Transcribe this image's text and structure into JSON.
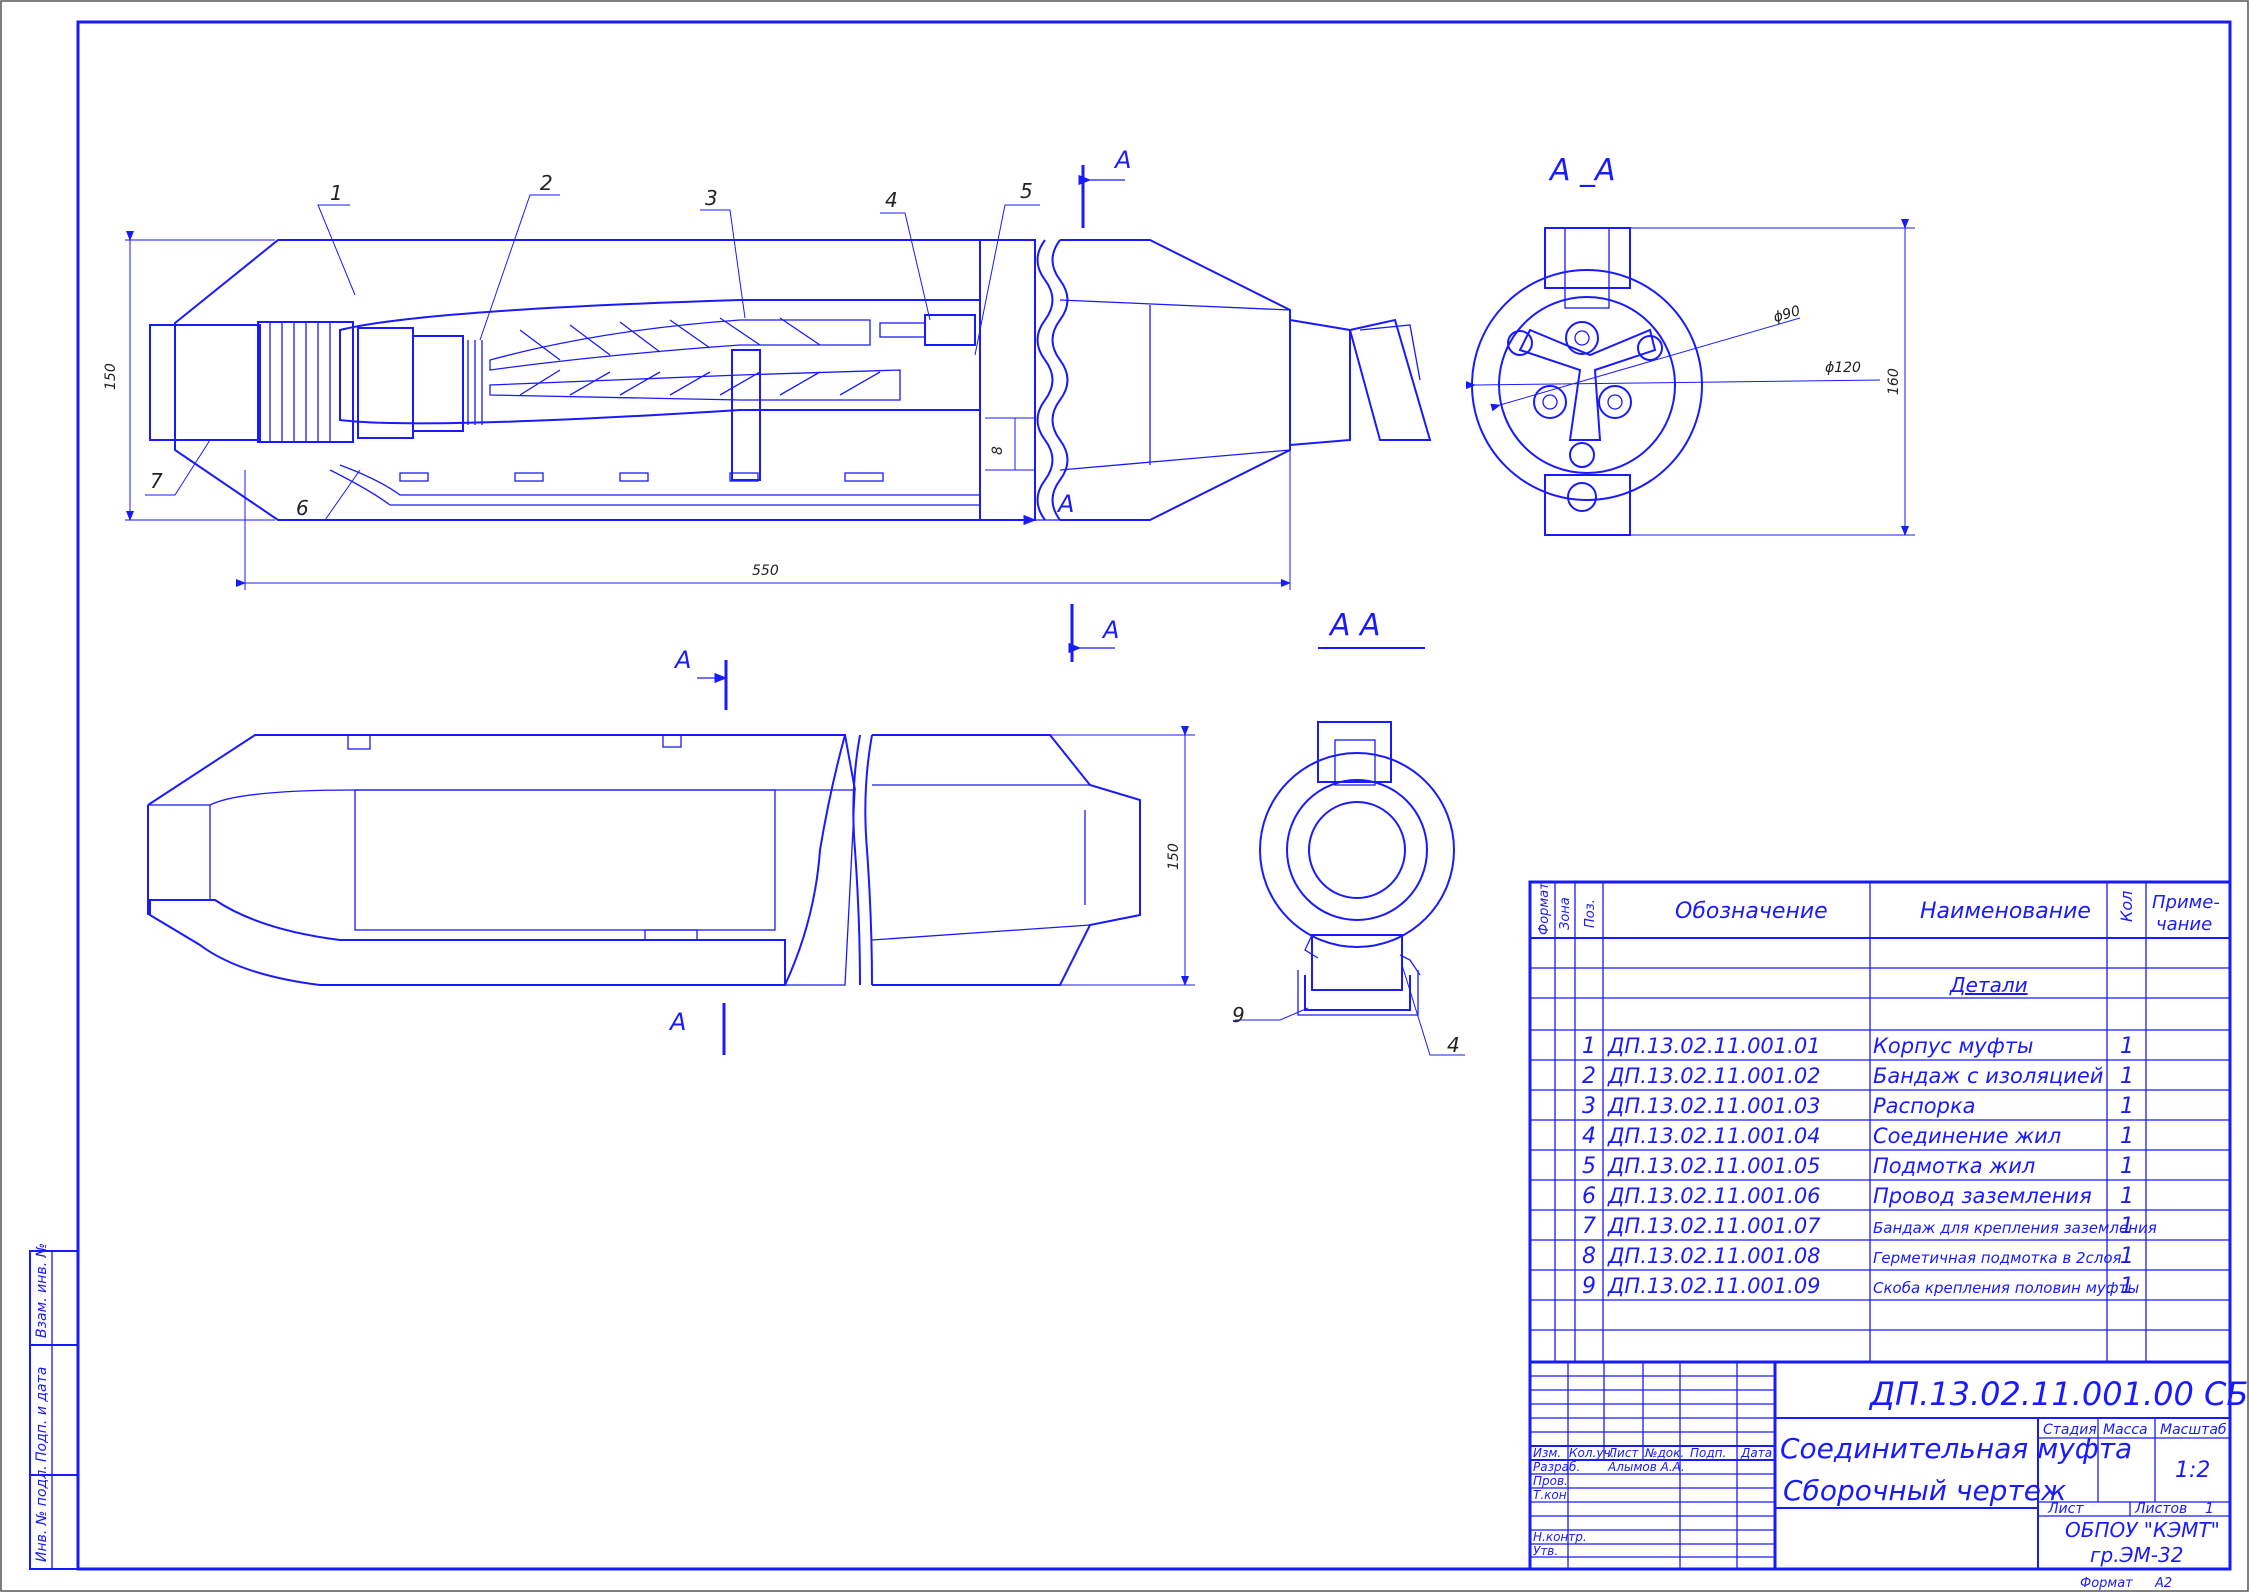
{
  "views": {
    "section_label_top": "А _А",
    "section_label_bottom": "А   А",
    "cut_mark": "А",
    "dims": {
      "length": "550",
      "height_top": "150",
      "height_bottom": "150",
      "gap": "8",
      "diam_90": "ϕ90",
      "diam_120": "ϕ120",
      "height_side": "160"
    },
    "callouts": [
      "1",
      "2",
      "3",
      "4",
      "5",
      "6",
      "7",
      "9",
      "4"
    ]
  },
  "spec": {
    "headers": {
      "format": "Формат",
      "zone": "Зона",
      "pos": "Поз.",
      "designation": "Обозначение",
      "name": "Наименование",
      "qty": "Кол",
      "note": "Приме-\nчание"
    },
    "section_title": "Детали",
    "rows": [
      {
        "pos": "1",
        "designation": "ДП.13.02.11.001.01",
        "name": "Корпус муфты",
        "qty": "1"
      },
      {
        "pos": "2",
        "designation": "ДП.13.02.11.001.02",
        "name": "Бандаж с изоляцией",
        "qty": "1"
      },
      {
        "pos": "3",
        "designation": "ДП.13.02.11.001.03",
        "name": "Распорка",
        "qty": "1"
      },
      {
        "pos": "4",
        "designation": "ДП.13.02.11.001.04",
        "name": "Соединение жил",
        "qty": "1"
      },
      {
        "pos": "5",
        "designation": "ДП.13.02.11.001.05",
        "name": "Подмотка жил",
        "qty": "1"
      },
      {
        "pos": "6",
        "designation": "ДП.13.02.11.001.06",
        "name": "Провод заземления",
        "qty": "1"
      },
      {
        "pos": "7",
        "designation": "ДП.13.02.11.001.07",
        "name": "Бандаж для  крепления заземления",
        "qty": "1"
      },
      {
        "pos": "8",
        "designation": "ДП.13.02.11.001.08",
        "name": "Герметичная подмотка в 2слоя",
        "qty": "1"
      },
      {
        "pos": "9",
        "designation": "ДП.13.02.11.001.09",
        "name": "Скоба крепления половин муфты",
        "qty": "1"
      }
    ]
  },
  "title_block": {
    "doc_number": "ДП.13.02.11.001.00 СБ",
    "title_line1": "Соединительная муфта",
    "title_line2": "Сборочный чертеж",
    "col_headers": [
      "Изм.",
      "Кол.уч.",
      "Лист",
      "№док.",
      "Подп.",
      "Дата"
    ],
    "roles": [
      "Разраб.",
      "Пров.",
      "Т.кон",
      "",
      "Н.контр.",
      "Утв."
    ],
    "developer": "Алымов А.А.",
    "stage_label": "Стадия",
    "mass_label": "Масса",
    "scale_label": "Масштаб",
    "scale": "1:2",
    "sheet_label": "Лист",
    "sheets_label": "Листов",
    "sheets_count": "1",
    "org_line1": "ОБПОУ \"КЭМТ\"",
    "org_line2": "гр.ЭМ-32",
    "format_label": "Формат",
    "format_value": "А2"
  },
  "side_stamp": [
    "Инв. № подл.",
    "Подп. и дата",
    "Взам. инв. №"
  ]
}
